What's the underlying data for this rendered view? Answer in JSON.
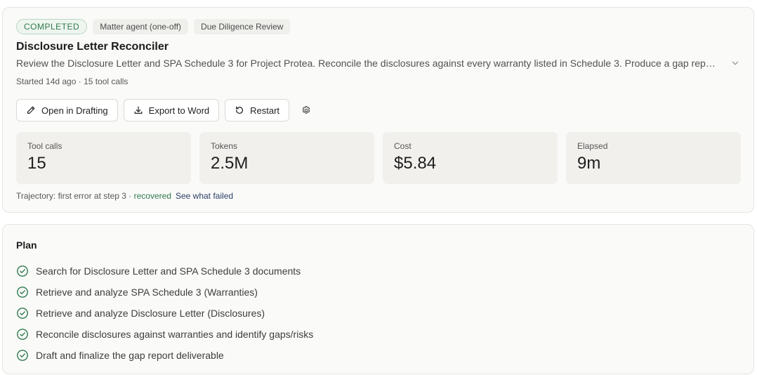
{
  "header": {
    "status_badge": "COMPLETED",
    "tags": [
      "Matter agent (one-off)",
      "Due Diligence Review"
    ],
    "title": "Disclosure Letter Reconciler",
    "description": "Review the Disclosure Letter and SPA Schedule 3 for Project Protea. Reconcile the disclosures against every warranty listed in Schedule 3. Produce a gap report flagging any warranty with missing, inadequate or overly general disclosure.",
    "meta": "Started 14d ago · 15 tool calls"
  },
  "actions": {
    "open_drafting": "Open in Drafting",
    "export_word": "Export to Word",
    "restart": "Restart",
    "settings_icon": "gear-icon"
  },
  "stats": [
    {
      "label": "Tool calls",
      "value": "15"
    },
    {
      "label": "Tokens",
      "value": "2.5M"
    },
    {
      "label": "Cost",
      "value": "$5.84"
    },
    {
      "label": "Elapsed",
      "value": "9m"
    }
  ],
  "trajectory": {
    "text": "Trajectory: first error at step 3 · ",
    "status": "recovered",
    "link": "See what failed"
  },
  "plan": {
    "title": "Plan",
    "items": [
      "Search for Disclosure Letter and SPA Schedule 3 documents",
      "Retrieve and analyze SPA Schedule 3 (Warranties)",
      "Retrieve and analyze Disclosure Letter (Disclosures)",
      "Reconcile disclosures against warranties and identify gaps/risks",
      "Draft and finalize the gap report deliverable"
    ]
  },
  "colors": {
    "success": "#2f7a4d",
    "link": "#2b3f66",
    "card_bg": "#fafaf9",
    "stat_bg": "#f1f0ed"
  }
}
